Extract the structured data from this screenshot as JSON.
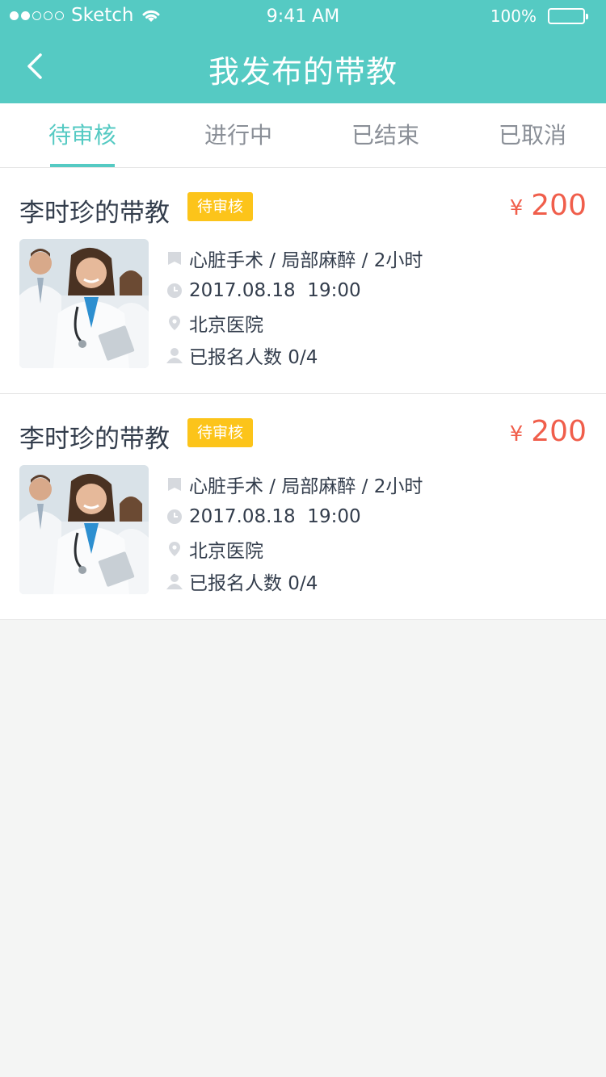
{
  "status_bar": {
    "carrier": "Sketch",
    "time": "9:41 AM",
    "battery": "100%"
  },
  "nav": {
    "title": "我发布的带教"
  },
  "tabs": [
    {
      "label": "待审核",
      "active": true
    },
    {
      "label": "进行中",
      "active": false
    },
    {
      "label": "已结束",
      "active": false
    },
    {
      "label": "已取消",
      "active": false
    }
  ],
  "cards": [
    {
      "title": "李时珍的带教",
      "badge": "待审核",
      "currency": "¥",
      "price": "200",
      "details": "心脏手术 / 局部麻醉 / 2小时",
      "datetime": "2017.08.18  19:00",
      "location": "北京医院",
      "enrolled": "已报名人数 0/4"
    },
    {
      "title": "李时珍的带教",
      "badge": "待审核",
      "currency": "¥",
      "price": "200",
      "details": "心脏手术 / 局部麻醉 / 2小时",
      "datetime": "2017.08.18  19:00",
      "location": "北京医院",
      "enrolled": "已报名人数 0/4"
    }
  ],
  "colors": {
    "accent": "#55cac3",
    "badge": "#fcc41a",
    "price": "#f05e4b"
  }
}
